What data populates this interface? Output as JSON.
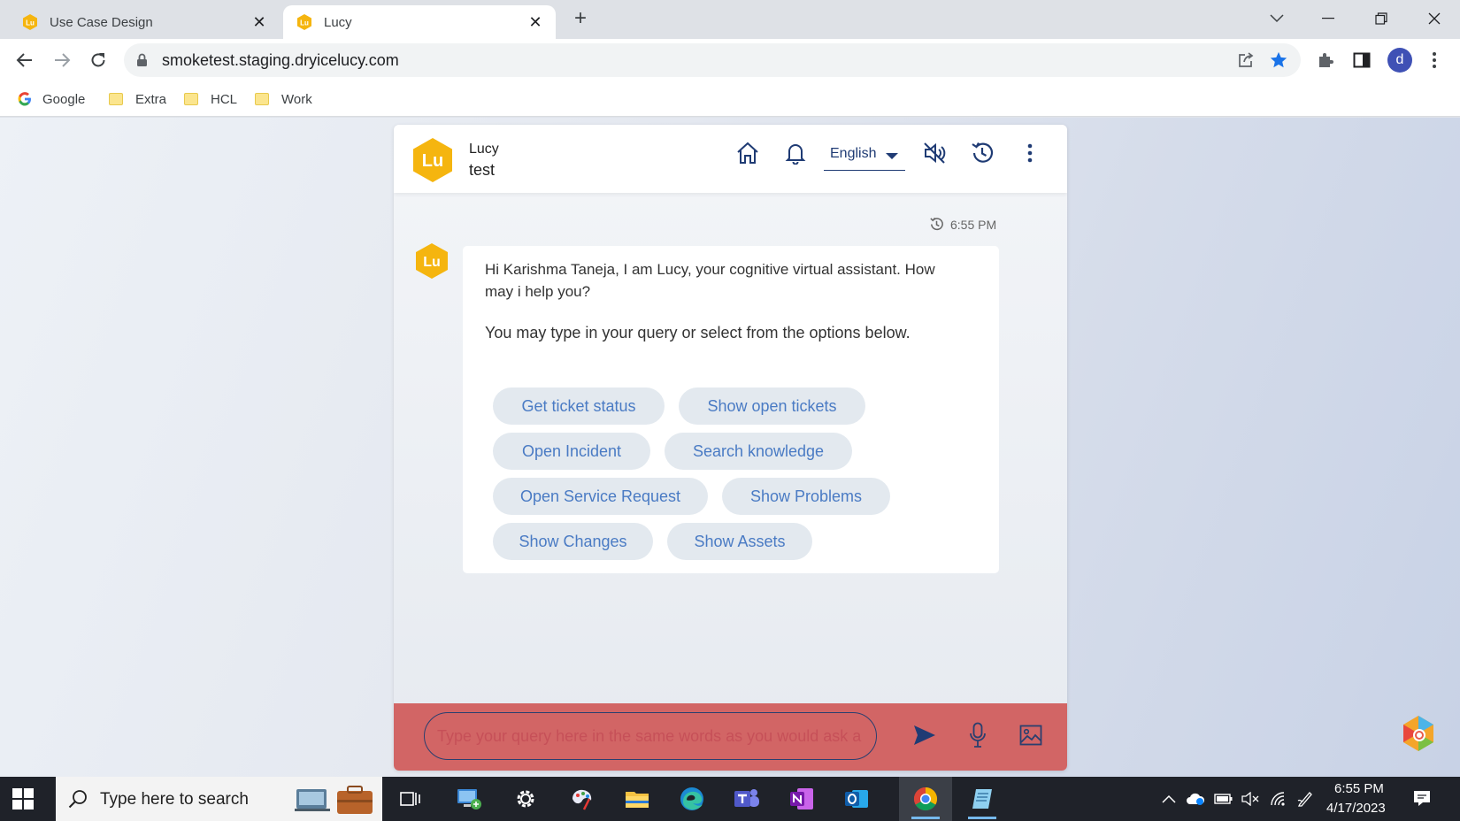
{
  "browser": {
    "tabs": [
      {
        "title": "Use Case Design",
        "active": false
      },
      {
        "title": "Lucy",
        "active": true
      }
    ],
    "url": "smoketest.staging.dryicelucy.com",
    "profile_initial": "d",
    "bookmarks": [
      "Google",
      "Extra",
      "HCL",
      "Work"
    ]
  },
  "app": {
    "logo_text": "Lu",
    "brand_name": "Lucy",
    "brand_sub": "test",
    "language": "English",
    "accent_color": "#f5b50f",
    "input_bar_color": "#d26565"
  },
  "chat": {
    "timestamp": "6:55 PM",
    "greeting": "Hi Karishma Taneja, I am Lucy, your cognitive virtual assistant. How may i help you?",
    "prompt": "You may type in your query or select from the options below.",
    "options": [
      "Get ticket status",
      "Show open tickets",
      "Open Incident",
      "Search knowledge",
      "Open Service Request",
      "Show Problems",
      "Show Changes",
      "Show Assets"
    ],
    "input_placeholder": "Type your query here in the same words as you would ask a person"
  },
  "taskbar": {
    "search_placeholder": "Type here to search",
    "time": "6:55 PM",
    "date": "4/17/2023",
    "apps": [
      "task-view",
      "remote-desktop",
      "settings",
      "snip-sketch",
      "file-explorer",
      "edge",
      "teams",
      "onenote",
      "outlook",
      "chrome",
      "notepad"
    ]
  }
}
